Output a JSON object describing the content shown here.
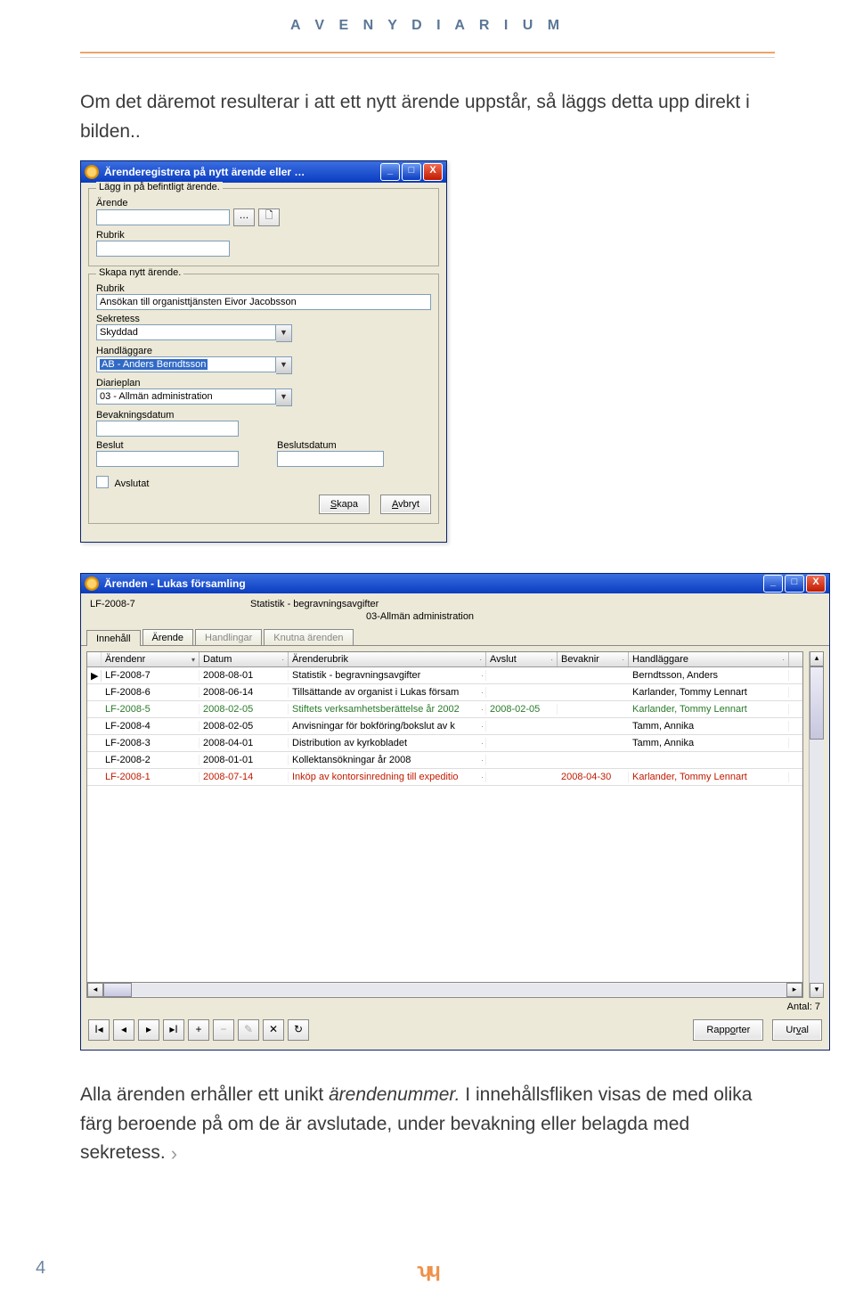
{
  "page": {
    "header": "A V E N Y   D I A R I U M",
    "para1": "Om det däremot resulterar i att ett nytt ärende uppstår, så läggs detta upp direkt i bilden..",
    "para2a": "Alla ärenden erhåller ett unikt ",
    "para2_em": "ärendenummer.",
    "para2b": " I innehållsfliken visas de med olika färg beroende på om de är avslutade, under bevakning eller belagda med sekretess.",
    "pagenum": "4",
    "logo": "ʮɥ"
  },
  "dialog": {
    "title": "Ärenderegistrera på nytt ärende eller …",
    "grp1_title": "Lägg in på befintligt ärende.",
    "arende_lbl": "Ärende",
    "browse": "…",
    "rubrik1_lbl": "Rubrik",
    "grp2_title": "Skapa nytt ärende.",
    "rubrik_lbl": "Rubrik",
    "rubrik_val": "Ansökan till organisttjänsten Eivor Jacobsson",
    "sekretess_lbl": "Sekretess",
    "sekretess_val": "Skyddad",
    "handlaggare_lbl": "Handläggare",
    "handlaggare_val": "AB - Anders Berndtsson",
    "diarieplan_lbl": "Diarieplan",
    "diarieplan_val": "03 - Allmän administration",
    "bevak_lbl": "Bevakningsdatum",
    "beslut_lbl": "Beslut",
    "beslutdatum_lbl": "Beslutsdatum",
    "avslutat_lbl": "Avslutat",
    "skapa_btn": "Skapa",
    "avbryt_btn": "Avbryt"
  },
  "list": {
    "title": "Ärenden - Lukas församling",
    "info_nr": "LF-2008-7",
    "info_rb": "Statistik - begravningsavgifter",
    "info_dp": "03-Allmän administration",
    "tabs": [
      "Innehåll",
      "Ärende",
      "Handlingar",
      "Knutna ärenden"
    ],
    "cols": {
      "nr": "Ärendenr",
      "dt": "Datum",
      "rb": "Ärenderubrik",
      "av": "Avslut",
      "be": "Bevaknir",
      "hl": "Handläggare"
    },
    "rows": [
      {
        "nr": "LF-2008-7",
        "dt": "2008-08-01",
        "rb": "Statistik - begravningsavgifter",
        "av": "",
        "be": "",
        "hl": "Berndtsson, Anders",
        "cls": "",
        "mk": "▶"
      },
      {
        "nr": "LF-2008-6",
        "dt": "2008-06-14",
        "rb": "Tillsättande av organist i Lukas försam",
        "av": "",
        "be": "",
        "hl": "Karlander, Tommy Lennart",
        "cls": "",
        "mk": ""
      },
      {
        "nr": "LF-2008-5",
        "dt": "2008-02-05",
        "rb": "Stiftets verksamhetsberättelse år 2002",
        "av": "2008-02-05",
        "be": "",
        "hl": "Karlander, Tommy Lennart",
        "cls": "green",
        "mk": ""
      },
      {
        "nr": "LF-2008-4",
        "dt": "2008-02-05",
        "rb": "Anvisningar för bokföring/bokslut av k",
        "av": "",
        "be": "",
        "hl": "Tamm, Annika",
        "cls": "",
        "mk": ""
      },
      {
        "nr": "LF-2008-3",
        "dt": "2008-04-01",
        "rb": "Distribution av kyrkobladet",
        "av": "",
        "be": "",
        "hl": "Tamm, Annika",
        "cls": "",
        "mk": ""
      },
      {
        "nr": "LF-2008-2",
        "dt": "2008-01-01",
        "rb": "Kollektansökningar år 2008",
        "av": "",
        "be": "",
        "hl": "",
        "cls": "",
        "mk": ""
      },
      {
        "nr": "LF-2008-1",
        "dt": "2008-07-14",
        "rb": "Inköp av kontorsinredning till expeditio",
        "av": "",
        "be": "2008-04-30",
        "hl": "Karlander, Tommy Lennart",
        "cls": "red",
        "mk": ""
      }
    ],
    "antal_lbl": "Antal:",
    "antal_val": "7",
    "rapporter_btn": "Rapporter",
    "urval_btn": "Urval"
  }
}
